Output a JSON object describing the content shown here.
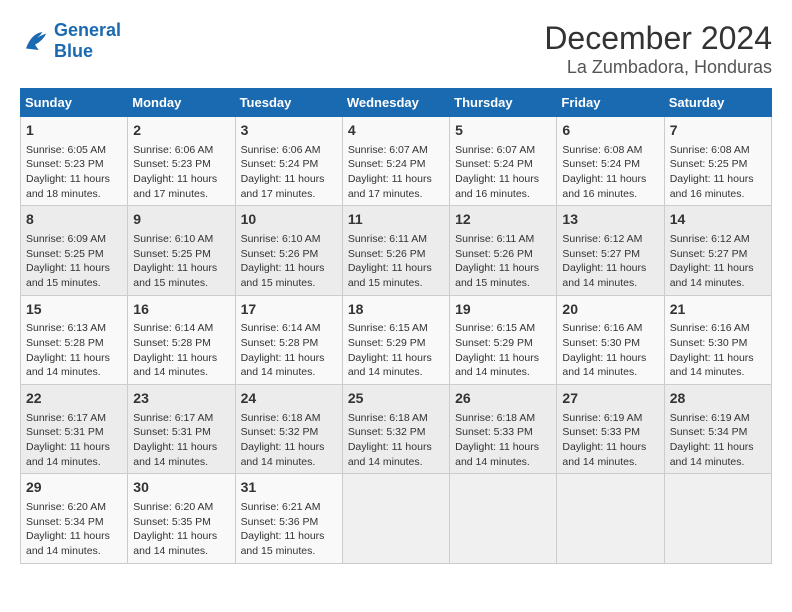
{
  "header": {
    "logo_line1": "General",
    "logo_line2": "Blue",
    "title": "December 2024",
    "subtitle": "La Zumbadora, Honduras"
  },
  "days_of_week": [
    "Sunday",
    "Monday",
    "Tuesday",
    "Wednesday",
    "Thursday",
    "Friday",
    "Saturday"
  ],
  "weeks": [
    [
      {
        "day": "1",
        "sunrise": "6:05 AM",
        "sunset": "5:23 PM",
        "daylight": "11 hours and 18 minutes."
      },
      {
        "day": "2",
        "sunrise": "6:06 AM",
        "sunset": "5:23 PM",
        "daylight": "11 hours and 17 minutes."
      },
      {
        "day": "3",
        "sunrise": "6:06 AM",
        "sunset": "5:24 PM",
        "daylight": "11 hours and 17 minutes."
      },
      {
        "day": "4",
        "sunrise": "6:07 AM",
        "sunset": "5:24 PM",
        "daylight": "11 hours and 17 minutes."
      },
      {
        "day": "5",
        "sunrise": "6:07 AM",
        "sunset": "5:24 PM",
        "daylight": "11 hours and 16 minutes."
      },
      {
        "day": "6",
        "sunrise": "6:08 AM",
        "sunset": "5:24 PM",
        "daylight": "11 hours and 16 minutes."
      },
      {
        "day": "7",
        "sunrise": "6:08 AM",
        "sunset": "5:25 PM",
        "daylight": "11 hours and 16 minutes."
      }
    ],
    [
      {
        "day": "8",
        "sunrise": "6:09 AM",
        "sunset": "5:25 PM",
        "daylight": "11 hours and 15 minutes."
      },
      {
        "day": "9",
        "sunrise": "6:10 AM",
        "sunset": "5:25 PM",
        "daylight": "11 hours and 15 minutes."
      },
      {
        "day": "10",
        "sunrise": "6:10 AM",
        "sunset": "5:26 PM",
        "daylight": "11 hours and 15 minutes."
      },
      {
        "day": "11",
        "sunrise": "6:11 AM",
        "sunset": "5:26 PM",
        "daylight": "11 hours and 15 minutes."
      },
      {
        "day": "12",
        "sunrise": "6:11 AM",
        "sunset": "5:26 PM",
        "daylight": "11 hours and 15 minutes."
      },
      {
        "day": "13",
        "sunrise": "6:12 AM",
        "sunset": "5:27 PM",
        "daylight": "11 hours and 14 minutes."
      },
      {
        "day": "14",
        "sunrise": "6:12 AM",
        "sunset": "5:27 PM",
        "daylight": "11 hours and 14 minutes."
      }
    ],
    [
      {
        "day": "15",
        "sunrise": "6:13 AM",
        "sunset": "5:28 PM",
        "daylight": "11 hours and 14 minutes."
      },
      {
        "day": "16",
        "sunrise": "6:14 AM",
        "sunset": "5:28 PM",
        "daylight": "11 hours and 14 minutes."
      },
      {
        "day": "17",
        "sunrise": "6:14 AM",
        "sunset": "5:28 PM",
        "daylight": "11 hours and 14 minutes."
      },
      {
        "day": "18",
        "sunrise": "6:15 AM",
        "sunset": "5:29 PM",
        "daylight": "11 hours and 14 minutes."
      },
      {
        "day": "19",
        "sunrise": "6:15 AM",
        "sunset": "5:29 PM",
        "daylight": "11 hours and 14 minutes."
      },
      {
        "day": "20",
        "sunrise": "6:16 AM",
        "sunset": "5:30 PM",
        "daylight": "11 hours and 14 minutes."
      },
      {
        "day": "21",
        "sunrise": "6:16 AM",
        "sunset": "5:30 PM",
        "daylight": "11 hours and 14 minutes."
      }
    ],
    [
      {
        "day": "22",
        "sunrise": "6:17 AM",
        "sunset": "5:31 PM",
        "daylight": "11 hours and 14 minutes."
      },
      {
        "day": "23",
        "sunrise": "6:17 AM",
        "sunset": "5:31 PM",
        "daylight": "11 hours and 14 minutes."
      },
      {
        "day": "24",
        "sunrise": "6:18 AM",
        "sunset": "5:32 PM",
        "daylight": "11 hours and 14 minutes."
      },
      {
        "day": "25",
        "sunrise": "6:18 AM",
        "sunset": "5:32 PM",
        "daylight": "11 hours and 14 minutes."
      },
      {
        "day": "26",
        "sunrise": "6:18 AM",
        "sunset": "5:33 PM",
        "daylight": "11 hours and 14 minutes."
      },
      {
        "day": "27",
        "sunrise": "6:19 AM",
        "sunset": "5:33 PM",
        "daylight": "11 hours and 14 minutes."
      },
      {
        "day": "28",
        "sunrise": "6:19 AM",
        "sunset": "5:34 PM",
        "daylight": "11 hours and 14 minutes."
      }
    ],
    [
      {
        "day": "29",
        "sunrise": "6:20 AM",
        "sunset": "5:34 PM",
        "daylight": "11 hours and 14 minutes."
      },
      {
        "day": "30",
        "sunrise": "6:20 AM",
        "sunset": "5:35 PM",
        "daylight": "11 hours and 14 minutes."
      },
      {
        "day": "31",
        "sunrise": "6:21 AM",
        "sunset": "5:36 PM",
        "daylight": "11 hours and 15 minutes."
      },
      null,
      null,
      null,
      null
    ]
  ],
  "labels": {
    "sunrise": "Sunrise:",
    "sunset": "Sunset:",
    "daylight": "Daylight:"
  }
}
